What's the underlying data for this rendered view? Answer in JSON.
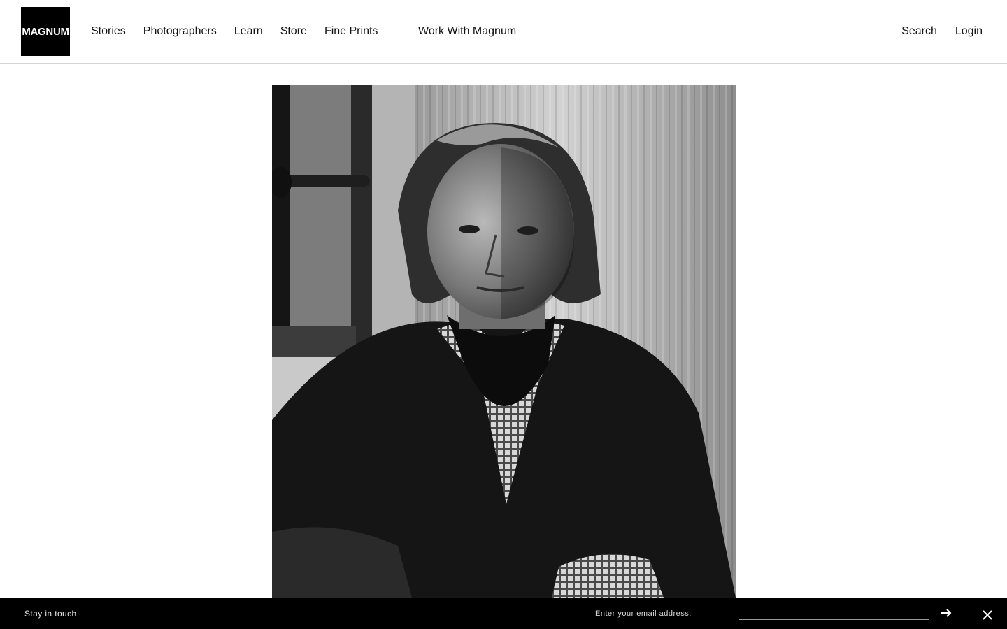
{
  "brand": {
    "logo_text": "MAGNUM"
  },
  "nav": {
    "main": [
      "Stories",
      "Photographers",
      "Learn",
      "Store",
      "Fine Prints"
    ],
    "work": "Work With Magnum",
    "search": "Search",
    "login": "Login"
  },
  "photo": {
    "subject": "black-and-white portrait of a seated man"
  },
  "newsletter": {
    "label": "Stay in touch",
    "email_label": "Enter your email address:",
    "email_value": "",
    "submit_icon": "arrow-right-icon",
    "close_icon": "close-icon"
  },
  "colors": {
    "header_bg": "#ffffff",
    "footer_bg": "#000000",
    "logo_bg": "#000000"
  }
}
